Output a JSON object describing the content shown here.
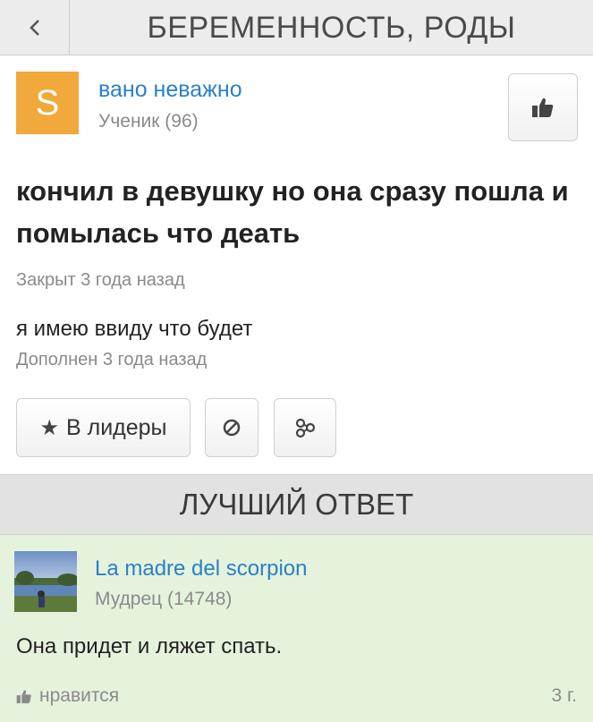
{
  "header": {
    "title": "БЕРЕМЕННОСТЬ, РОДЫ"
  },
  "question": {
    "author": {
      "avatar_letter": "S",
      "name": "вано неважно",
      "rank": "Ученик (96)"
    },
    "text": "кончил в девушку но она сразу пошла и помылась что деать",
    "closed": "Закрыт 3 года назад",
    "addition": "я имею ввиду что будет",
    "added": "Дополнен 3 года назад"
  },
  "actions": {
    "leaders_label": "В лидеры"
  },
  "best_answer": {
    "section_title": "ЛУЧШИЙ ОТВЕТ",
    "author": {
      "name": "La madre del scorpion",
      "rank": "Мудрец (14748)"
    },
    "text": "Она придет и ляжет спать.",
    "likes_label": "нравится",
    "time": "3 г."
  },
  "colors": {
    "accent": "#2a80c9",
    "avatar": "#f2a93b",
    "answer_bg": "#e5f3dd"
  },
  "icons": [
    "chevron-left-icon",
    "thumbs-up-icon",
    "star-icon",
    "block-icon",
    "share-icon"
  ]
}
